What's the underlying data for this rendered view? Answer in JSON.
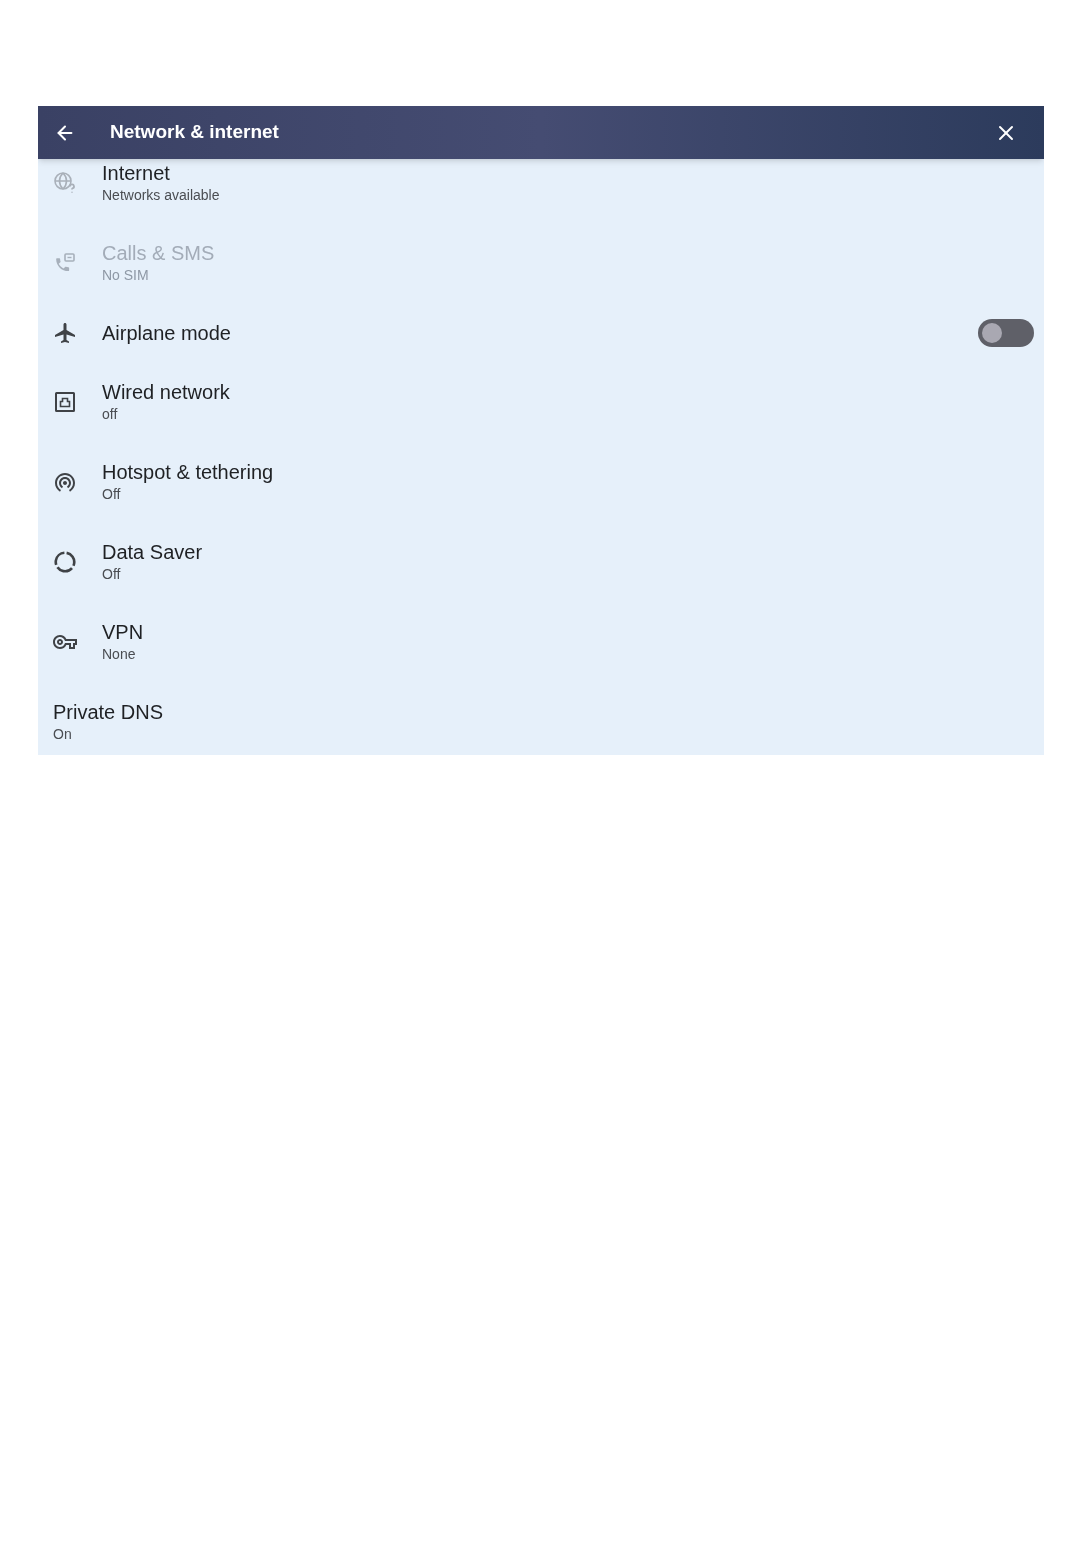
{
  "header": {
    "title": "Network & internet"
  },
  "items": [
    {
      "kind": "link",
      "title": "Internet",
      "subtitle": "Networks available",
      "disabled": false
    },
    {
      "kind": "link",
      "title": "Calls & SMS",
      "subtitle": "No SIM",
      "disabled": true
    },
    {
      "kind": "switch",
      "title": "Airplane mode",
      "on": false,
      "disabled": false
    },
    {
      "kind": "link",
      "title": "Wired network",
      "subtitle": "off",
      "disabled": false
    },
    {
      "kind": "link",
      "title": "Hotspot & tethering",
      "subtitle": "Off",
      "disabled": false
    },
    {
      "kind": "link",
      "title": "Data Saver",
      "subtitle": "Off",
      "disabled": false
    },
    {
      "kind": "link",
      "title": "VPN",
      "subtitle": "None",
      "disabled": false
    },
    {
      "kind": "link",
      "title": "Private DNS",
      "subtitle": "On",
      "disabled": false
    }
  ]
}
